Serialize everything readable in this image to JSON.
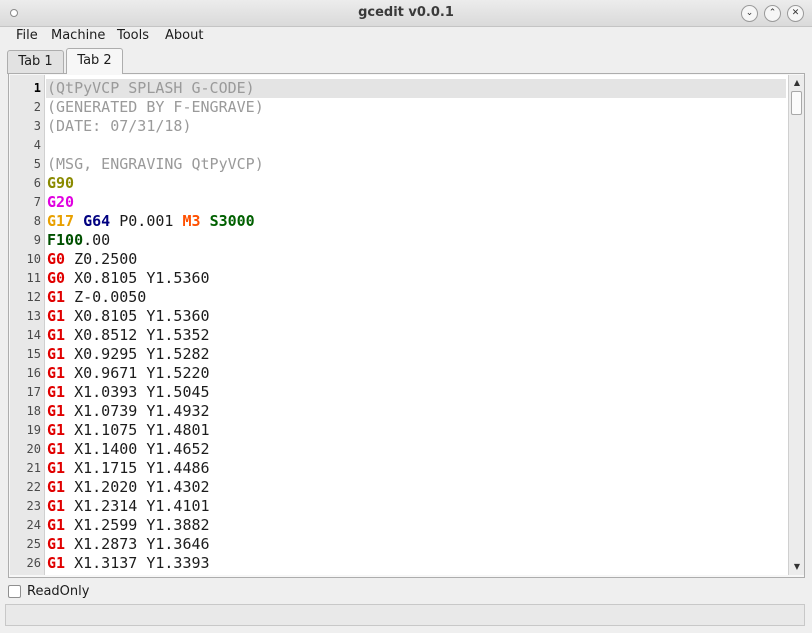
{
  "window": {
    "title": "gcedit v0.0.1",
    "buttons": [
      "minimize-icon",
      "maximize-icon",
      "close-icon"
    ]
  },
  "menu": [
    "File",
    "Machine",
    "Tools",
    "About"
  ],
  "tabs": [
    {
      "label": "Tab 1",
      "active": false
    },
    {
      "label": "Tab 2",
      "active": true
    }
  ],
  "editor": {
    "current_line": 1,
    "line_numbers": [
      "1",
      "2",
      "3",
      "4",
      "5",
      "6",
      "7",
      "8",
      "9",
      "10",
      "11",
      "12",
      "13",
      "14",
      "15",
      "16",
      "17",
      "18",
      "19",
      "20",
      "21",
      "22",
      "23",
      "24",
      "25",
      "26"
    ],
    "lines": [
      [
        {
          "t": "(QtPyVCP SPLASH G-CODE)",
          "c": "comment"
        }
      ],
      [
        {
          "t": "(GENERATED BY F-ENGRAVE)",
          "c": "comment"
        }
      ],
      [
        {
          "t": "(DATE: 07/31/18)",
          "c": "comment"
        }
      ],
      [],
      [
        {
          "t": "(MSG, ENGRAVING QtPyVCP)",
          "c": "comment"
        }
      ],
      [
        {
          "t": "G90",
          "c": "g90"
        }
      ],
      [
        {
          "t": "G20",
          "c": "g20"
        }
      ],
      [
        {
          "t": "G17",
          "c": "g17"
        },
        {
          "t": " ",
          "c": "plain"
        },
        {
          "t": "G64",
          "c": "g64"
        },
        {
          "t": " P0.001 ",
          "c": "plain"
        },
        {
          "t": "M3",
          "c": "m3"
        },
        {
          "t": " ",
          "c": "plain"
        },
        {
          "t": "S3000",
          "c": "s"
        }
      ],
      [
        {
          "t": "F100",
          "c": "f"
        },
        {
          "t": ".00",
          "c": "plain"
        }
      ],
      [
        {
          "t": "G0",
          "c": "g01"
        },
        {
          "t": " Z0.2500",
          "c": "plain"
        }
      ],
      [
        {
          "t": "G0",
          "c": "g01"
        },
        {
          "t": " X0.8105 Y1.5360",
          "c": "plain"
        }
      ],
      [
        {
          "t": "G1",
          "c": "g01"
        },
        {
          "t": " Z-0.0050",
          "c": "plain"
        }
      ],
      [
        {
          "t": "G1",
          "c": "g01"
        },
        {
          "t": " X0.8105 Y1.5360",
          "c": "plain"
        }
      ],
      [
        {
          "t": "G1",
          "c": "g01"
        },
        {
          "t": " X0.8512 Y1.5352",
          "c": "plain"
        }
      ],
      [
        {
          "t": "G1",
          "c": "g01"
        },
        {
          "t": " X0.9295 Y1.5282",
          "c": "plain"
        }
      ],
      [
        {
          "t": "G1",
          "c": "g01"
        },
        {
          "t": " X0.9671 Y1.5220",
          "c": "plain"
        }
      ],
      [
        {
          "t": "G1",
          "c": "g01"
        },
        {
          "t": " X1.0393 Y1.5045",
          "c": "plain"
        }
      ],
      [
        {
          "t": "G1",
          "c": "g01"
        },
        {
          "t": " X1.0739 Y1.4932",
          "c": "plain"
        }
      ],
      [
        {
          "t": "G1",
          "c": "g01"
        },
        {
          "t": " X1.1075 Y1.4801",
          "c": "plain"
        }
      ],
      [
        {
          "t": "G1",
          "c": "g01"
        },
        {
          "t": " X1.1400 Y1.4652",
          "c": "plain"
        }
      ],
      [
        {
          "t": "G1",
          "c": "g01"
        },
        {
          "t": " X1.1715 Y1.4486",
          "c": "plain"
        }
      ],
      [
        {
          "t": "G1",
          "c": "g01"
        },
        {
          "t": " X1.2020 Y1.4302",
          "c": "plain"
        }
      ],
      [
        {
          "t": "G1",
          "c": "g01"
        },
        {
          "t": " X1.2314 Y1.4101",
          "c": "plain"
        }
      ],
      [
        {
          "t": "G1",
          "c": "g01"
        },
        {
          "t": " X1.2599 Y1.3882",
          "c": "plain"
        }
      ],
      [
        {
          "t": "G1",
          "c": "g01"
        },
        {
          "t": " X1.2873 Y1.3646",
          "c": "plain"
        }
      ],
      [
        {
          "t": "G1",
          "c": "g01"
        },
        {
          "t": " X1.3137 Y1.3393",
          "c": "plain"
        }
      ]
    ]
  },
  "scrollbar": {
    "up_icon": "arrow-up-icon",
    "down_icon": "arrow-down-icon",
    "position": 0.0
  },
  "readonly": {
    "label": "ReadOnly",
    "checked": false
  }
}
